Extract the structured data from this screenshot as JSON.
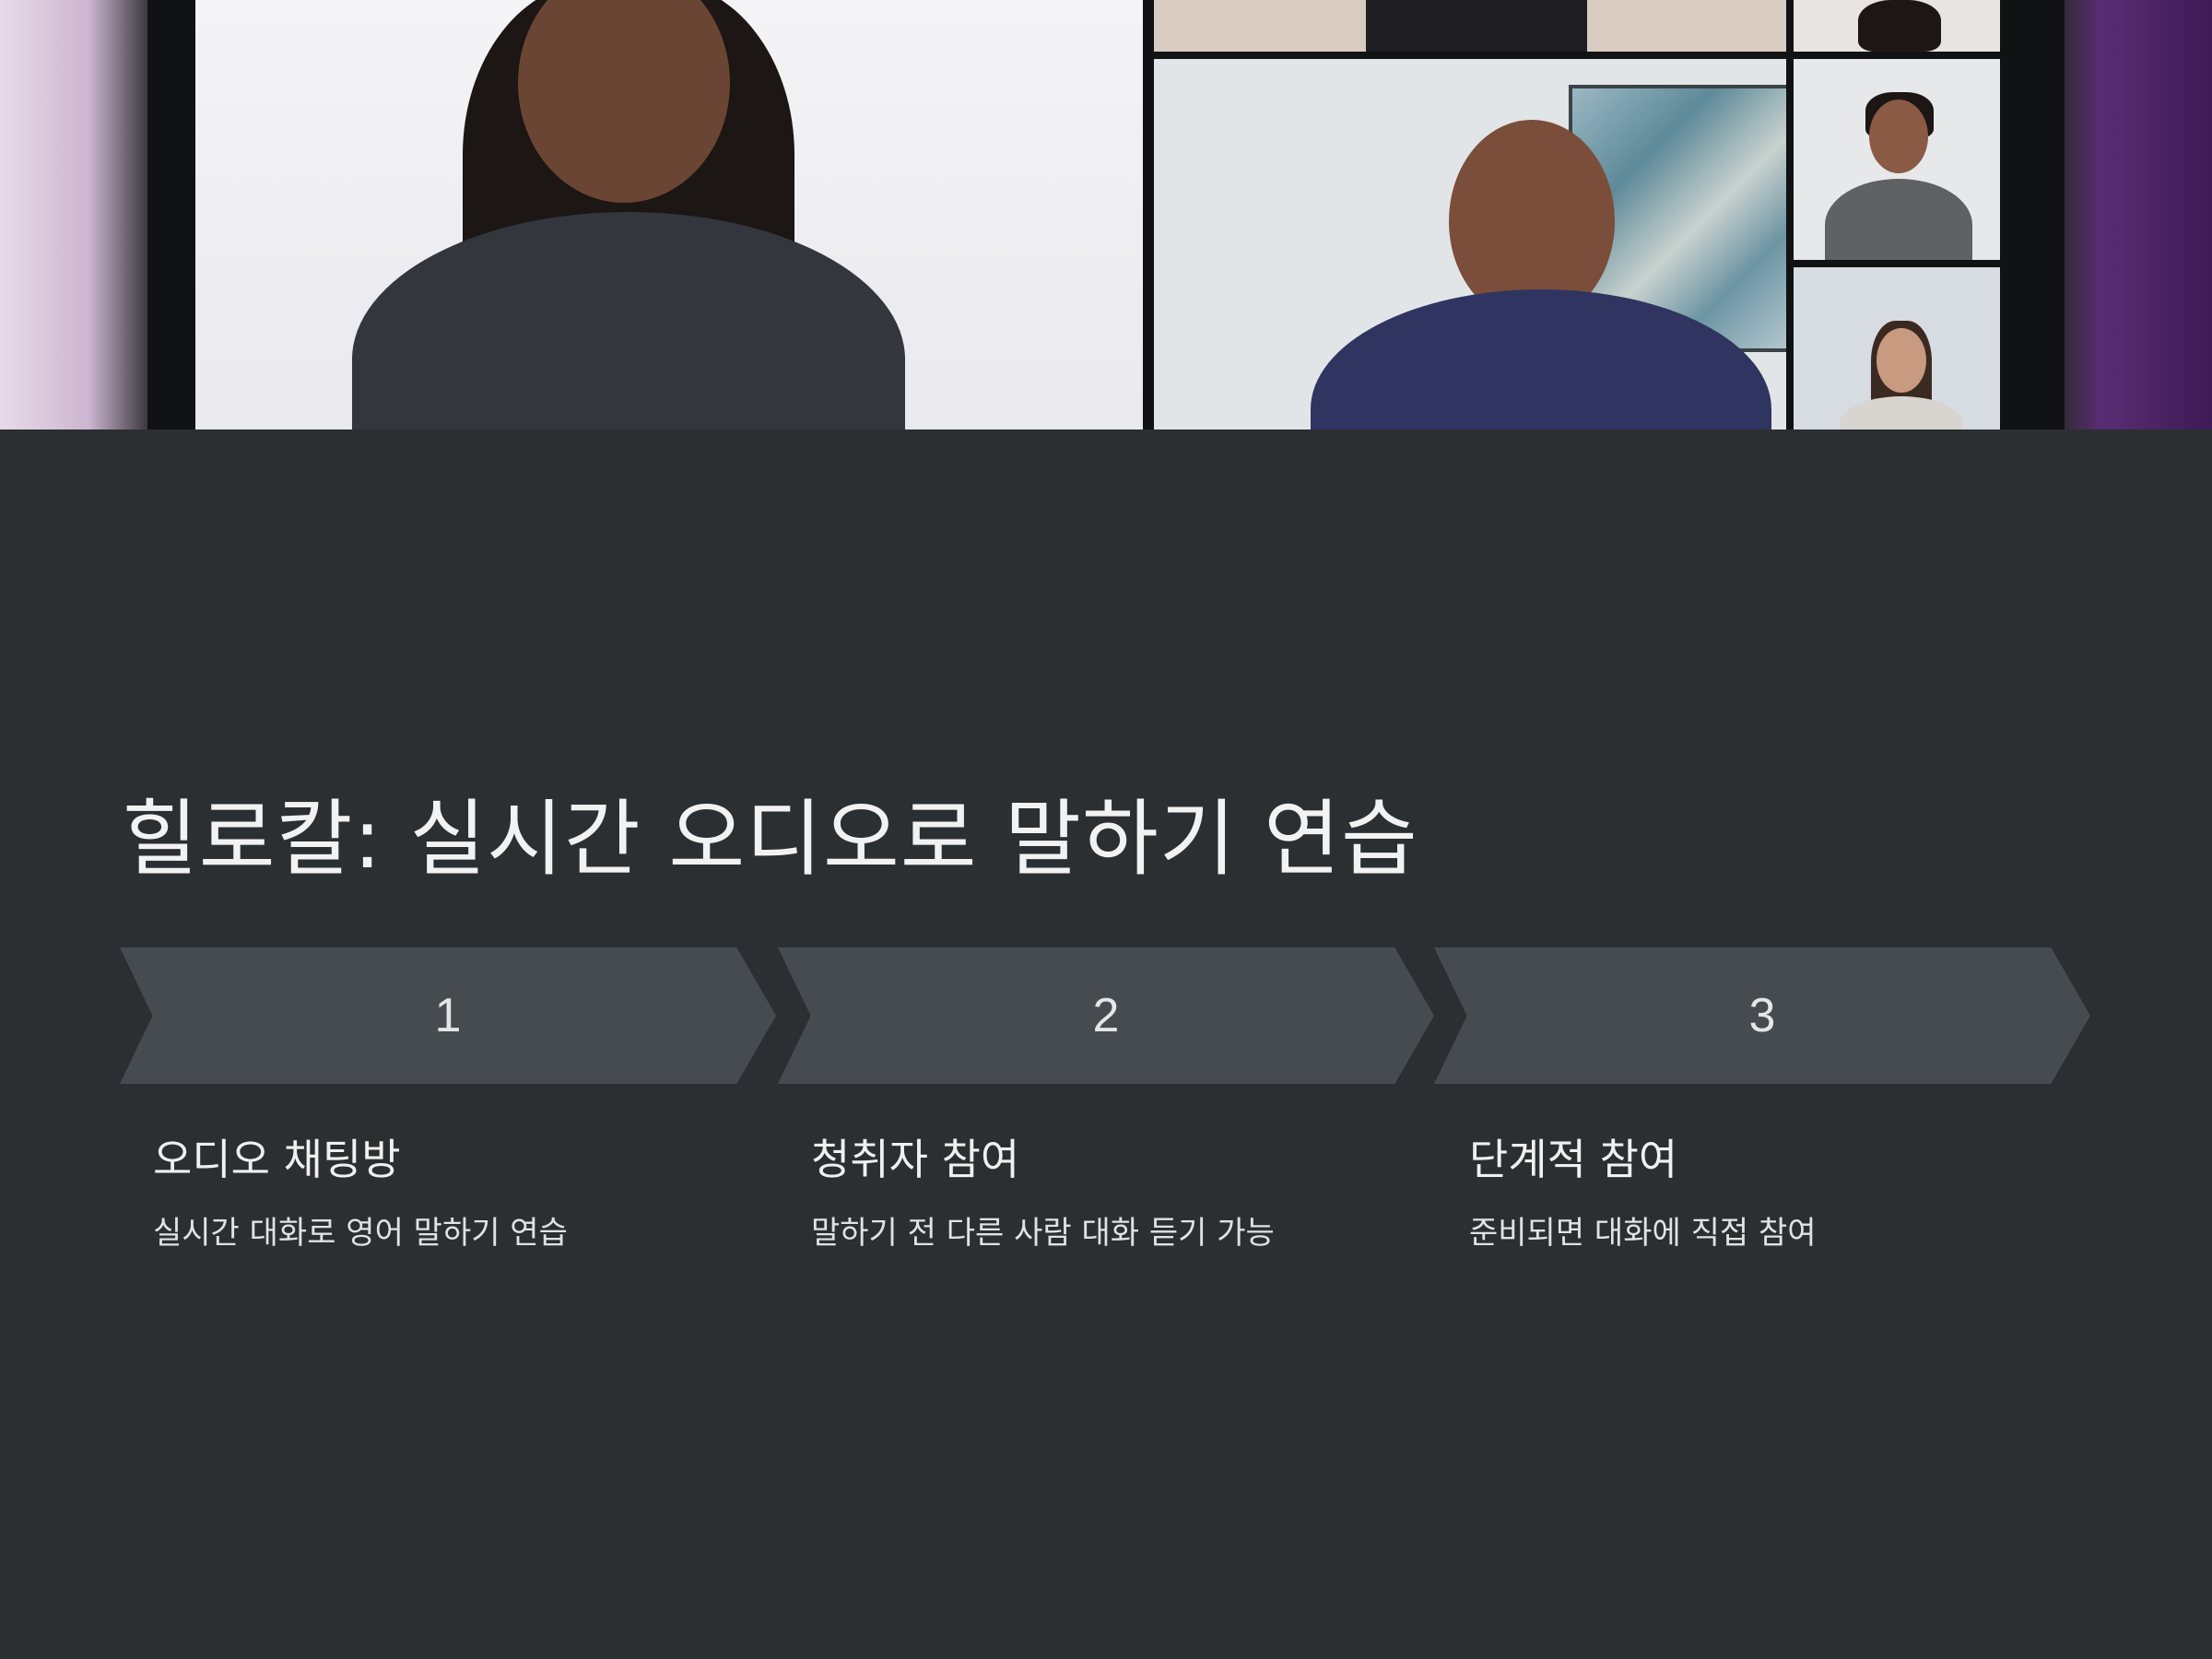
{
  "hero": {
    "alt": "",
    "icons": [
      "video-call-grid"
    ]
  },
  "title": "힐로칼: 실시간 오디오로 말하기 연습",
  "steps": [
    {
      "number": "1",
      "title": "오디오 채팅방",
      "description": "실시간 대화로 영어 말하기 연습"
    },
    {
      "number": "2",
      "title": "청취자 참여",
      "description": "말하기 전 다른 사람 대화 듣기 가능"
    },
    {
      "number": "3",
      "title": "단계적 참여",
      "description": "준비되면 대화에 직접 참여"
    }
  ],
  "colors": {
    "background": "#2b2f32",
    "chevron": "#464b4f",
    "text": "#f2f2f2"
  }
}
